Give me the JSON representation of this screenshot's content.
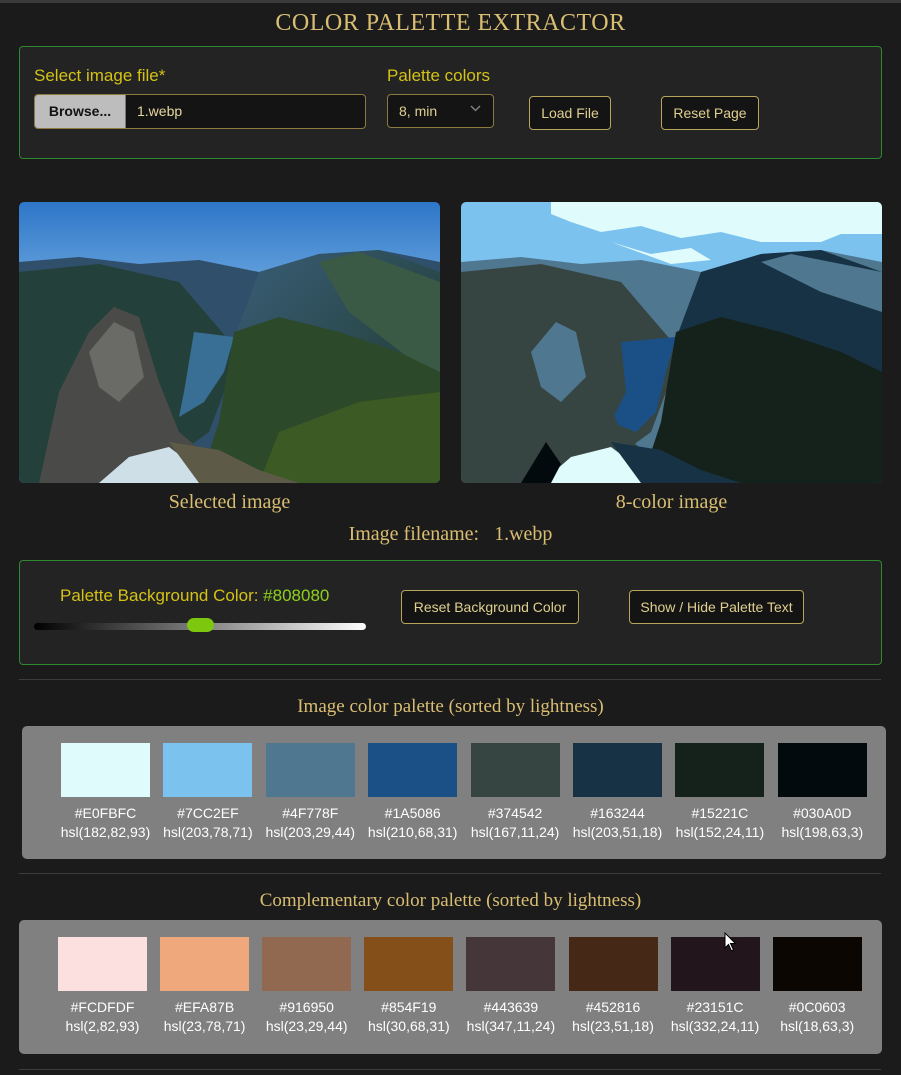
{
  "app_title": "COLOR PALETTE EXTRACTOR",
  "file_panel": {
    "select_label": "Select image file*",
    "browse_label": "Browse...",
    "file_name": "1.webp",
    "palette_label": "Palette colors",
    "palette_selected": "8, min",
    "load_button": "Load File",
    "reset_button": "Reset Page"
  },
  "images": {
    "left_caption": "Selected image",
    "right_caption": "8-color image",
    "filename_label": "Image filename:",
    "filename_value": "1.webp"
  },
  "bg_panel": {
    "label": "Palette Background Color: ",
    "value": "#808080",
    "slider_level": 0.5,
    "reset_button": "Reset Background Color",
    "toggle_button": "Show / Hide Palette Text"
  },
  "image_palette": {
    "title": "Image color palette (sorted by lightness)",
    "colors": [
      {
        "hex": "#E0FBFC",
        "hsl": "hsl(182,82,93)"
      },
      {
        "hex": "#7CC2EF",
        "hsl": "hsl(203,78,71)"
      },
      {
        "hex": "#4F778F",
        "hsl": "hsl(203,29,44)"
      },
      {
        "hex": "#1A5086",
        "hsl": "hsl(210,68,31)"
      },
      {
        "hex": "#374542",
        "hsl": "hsl(167,11,24)"
      },
      {
        "hex": "#163244",
        "hsl": "hsl(203,51,18)"
      },
      {
        "hex": "#15221C",
        "hsl": "hsl(152,24,11)"
      },
      {
        "hex": "#030A0D",
        "hsl": "hsl(198,63,3)"
      }
    ]
  },
  "complementary_palette": {
    "title": "Complementary color palette (sorted by lightness)",
    "colors": [
      {
        "hex": "#FCDFDF",
        "hsl": "hsl(2,82,93)"
      },
      {
        "hex": "#EFA87B",
        "hsl": "hsl(23,78,71)"
      },
      {
        "hex": "#916950",
        "hsl": "hsl(23,29,44)"
      },
      {
        "hex": "#854F19",
        "hsl": "hsl(30,68,31)"
      },
      {
        "hex": "#443639",
        "hsl": "hsl(347,11,24)"
      },
      {
        "hex": "#452816",
        "hsl": "hsl(23,51,18)"
      },
      {
        "hex": "#23151C",
        "hsl": "hsl(332,24,11)"
      },
      {
        "hex": "#0C0603",
        "hsl": "hsl(18,63,3)"
      }
    ]
  },
  "colors": {
    "accent_green": "#7ec70f",
    "label_yellow": "#d4c217",
    "title_gold": "#d9be72",
    "border_green": "#2f8a2f"
  }
}
